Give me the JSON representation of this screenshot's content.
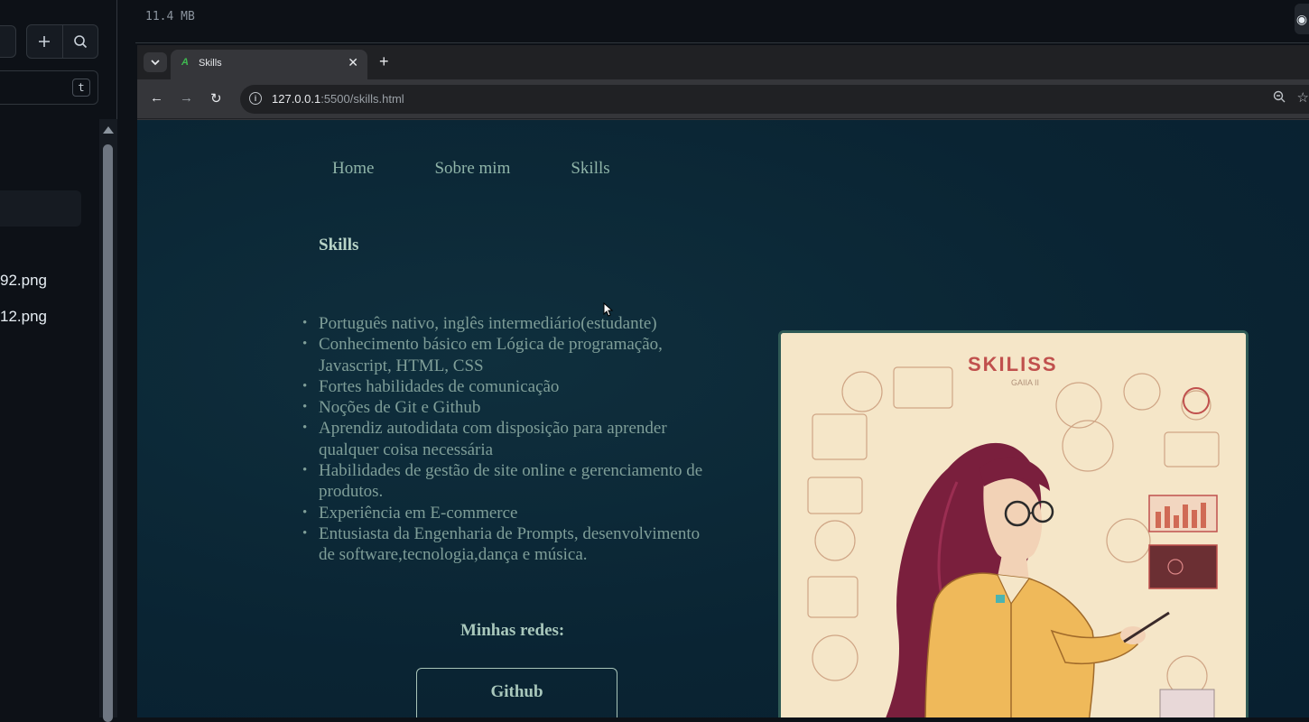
{
  "editor": {
    "filter_shortcut": "t",
    "files": [
      {
        "name": "92.png"
      },
      {
        "name": "12.png"
      }
    ]
  },
  "status": {
    "memory": "11.4 MB"
  },
  "browser": {
    "tab": {
      "title": "Skills",
      "favicon": "A"
    },
    "url": {
      "host": "127.0.0.1",
      "path": ":5500/skills.html"
    }
  },
  "page": {
    "nav": [
      "Home",
      "Sobre mim",
      "Skills"
    ],
    "title": "Skills",
    "skills": [
      "Português nativo, inglês intermediário(estudante)",
      "Conhecimento básico em Lógica de programação, Javascript, HTML, CSS",
      "Fortes habilidades de comunicação",
      "Noções de Git e Github",
      "Aprendiz autodidata com disposição para aprender qualquer coisa necessária",
      "Habilidades de gestão de site online e gerenciamento de produtos.",
      "Experiência em E-commerce",
      "Entusiasta da Engenharia de Prompts, desenvolvimento de software,tecnologia,dança e música."
    ],
    "social_title": "Minhas redes:",
    "github_button": "Github",
    "illustration": {
      "title": "SKILISS",
      "subtitle": "GAIIA II"
    }
  }
}
